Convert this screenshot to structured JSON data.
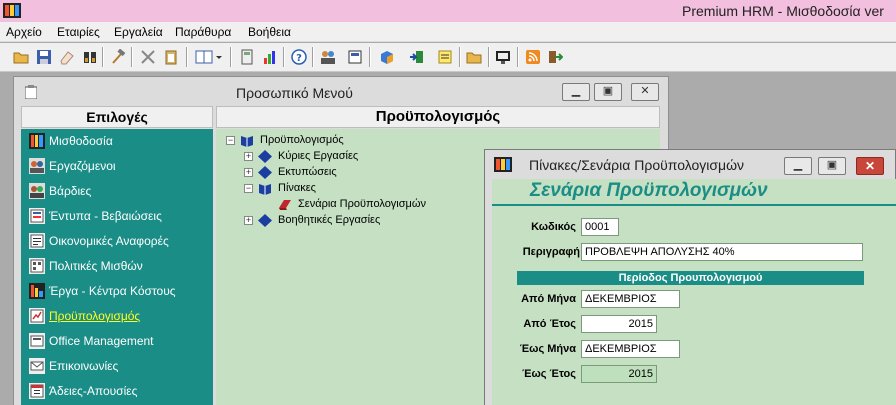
{
  "app": {
    "title": "Premium HRM - Μισθοδοσία ver"
  },
  "menu": [
    "Αρχείο",
    "Εταιρίες",
    "Εργαλεία",
    "Παράθυρα",
    "Βοήθεια"
  ],
  "toolbar_icons": [
    "open-folder-icon",
    "save-icon",
    "eraser-icon",
    "binoculars-icon",
    "hammer-icon",
    "tools-icon",
    "clipboard-icon",
    "layout-icon",
    "calculator-icon",
    "chart-icon",
    "help-icon",
    "users-icon",
    "document-icon",
    "package-icon",
    "exit-door-icon",
    "notes-icon",
    "folder-icon",
    "monitor-icon",
    "rss-icon",
    "logout-icon"
  ],
  "personnel_window": {
    "title": "Προσωπικό Μενού",
    "options_header": "Επιλογές",
    "content_header": "Προϋπολογισμός",
    "sidebar": [
      {
        "label": "Μισθοδοσία",
        "icon": "payroll-icon"
      },
      {
        "label": "Εργαζόμενοι",
        "icon": "employees-icon"
      },
      {
        "label": "Βάρδιες",
        "icon": "shifts-icon"
      },
      {
        "label": "Έντυπα - Βεβαιώσεις",
        "icon": "forms-icon"
      },
      {
        "label": "Οικονομικές Αναφορές",
        "icon": "financial-reports-icon"
      },
      {
        "label": "Πολιτικές Μισθών",
        "icon": "wage-policies-icon"
      },
      {
        "label": "Έργα - Κέντρα Κόστους",
        "icon": "cost-centers-icon"
      },
      {
        "label": "Προϋπολογισμός",
        "icon": "budget-icon",
        "active": true
      },
      {
        "label": "Office Management",
        "icon": "office-icon"
      },
      {
        "label": "Επικοινωνίες",
        "icon": "communications-icon"
      },
      {
        "label": "Άδειες-Απουσίες",
        "icon": "leaves-icon"
      }
    ],
    "tree": {
      "root": "Προϋπολογισμός",
      "main_tasks": "Κύριες Εργασίες",
      "prints": "Εκτυπώσεις",
      "tables": "Πίνακες",
      "scenarios": "Σενάρια Προϋπολογισμών",
      "aux_tasks": "Βοηθητικές Εργασίες"
    }
  },
  "scenario_window": {
    "title": "Πίνακες/Σενάρια Προϋπολογισμών",
    "heading": "Σενάρια Προϋπολογισμών",
    "code_label": "Κωδικός",
    "code_value": "0001",
    "description_label": "Περιγραφή",
    "description_value": "ΠΡΟΒΛΕΨΗ ΑΠΟΛΥΣΗΣ 40%",
    "period_header": "Περίοδος Προυπολογισμού",
    "from_month_label": "Από Μήνα",
    "from_month_value": "ΔΕΚΕΜΒΡΙΟΣ",
    "from_year_label": "Από Έτος",
    "from_year_value": "2015",
    "to_month_label": "Έως Μήνα",
    "to_month_value": "ΔΕΚΕΜΒΡΙΟΣ",
    "to_year_label": "Έως Έτος",
    "to_year_value": "2015"
  },
  "colors": {
    "teal": "#1b8d87",
    "light_green": "#c5e0c2",
    "titlebar_pink": "#f2bfde",
    "active_yellow": "#ffff20"
  }
}
